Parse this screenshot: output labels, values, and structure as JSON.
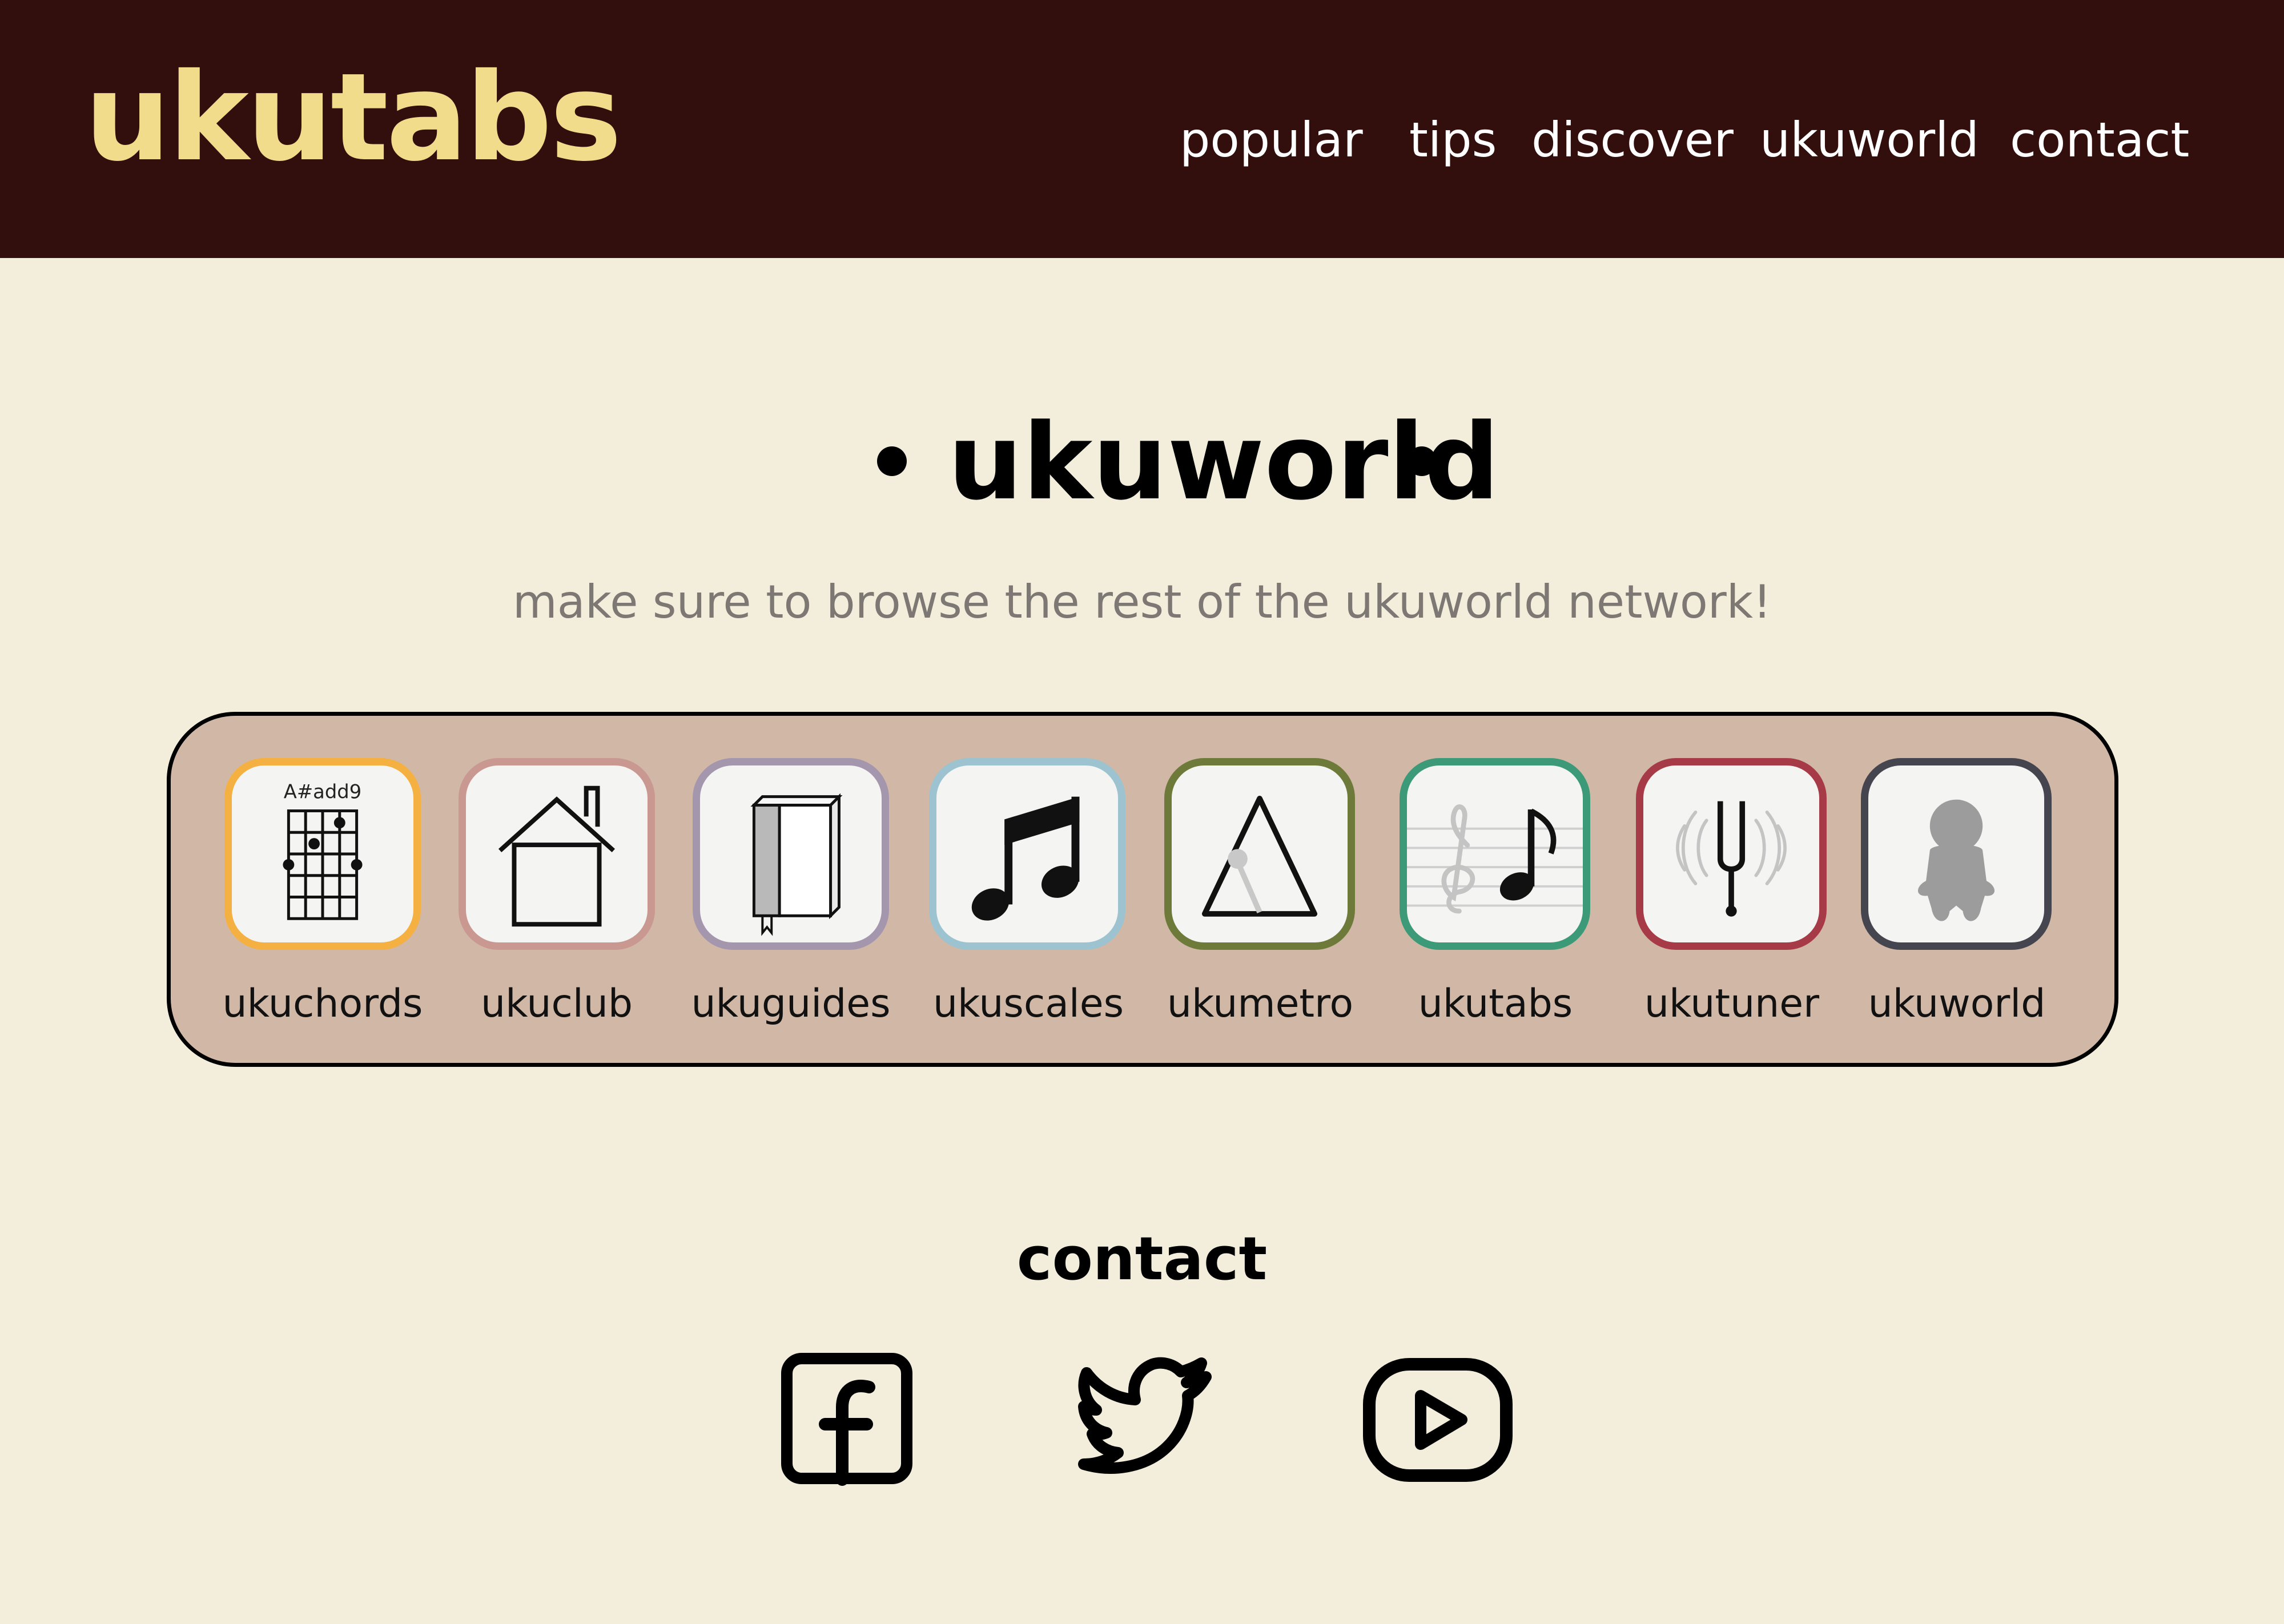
{
  "header": {
    "logo": "ukutabs",
    "nav": [
      "popular",
      "tips",
      "discover",
      "ukuworld",
      "contact"
    ]
  },
  "hero": {
    "title": "ukuworld",
    "subtitle": "make sure to browse the rest of the ukuworld network!"
  },
  "network": {
    "apps": [
      {
        "label": "ukuchords",
        "icon": "chord-diagram-icon",
        "border": "#f5b042",
        "chord": "A#add9"
      },
      {
        "label": "ukuclub",
        "icon": "house-icon",
        "border": "#c99890"
      },
      {
        "label": "ukuguides",
        "icon": "book-icon",
        "border": "#a497ad"
      },
      {
        "label": "ukuscales",
        "icon": "music-notes-icon",
        "border": "#9cc3cf"
      },
      {
        "label": "ukumetro",
        "icon": "metronome-icon",
        "border": "#6e7a3a"
      },
      {
        "label": "ukutabs",
        "icon": "staff-note-icon",
        "border": "#3d9a78"
      },
      {
        "label": "ukutuner",
        "icon": "tuning-fork-icon",
        "border": "#a73a47"
      },
      {
        "label": "ukuworld",
        "icon": "figure-icon",
        "border": "#454550"
      }
    ]
  },
  "contact": {
    "title": "contact",
    "socials": [
      "facebook-icon",
      "twitter-icon",
      "youtube-icon"
    ]
  },
  "colors": {
    "header_bg": "#320f0d",
    "logo": "#f0dc8a",
    "page_bg": "#f3eedb",
    "panel_bg": "#d1b8a6"
  }
}
